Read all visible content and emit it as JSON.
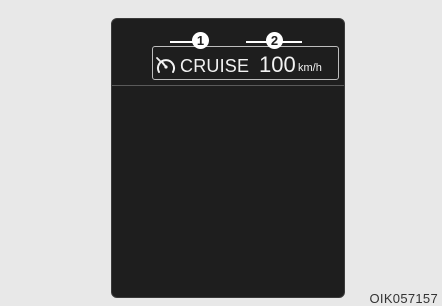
{
  "display": {
    "mode_label": "CRUISE",
    "set_speed": "100",
    "speed_unit": "km/h",
    "icon": "cruise-speedometer-icon"
  },
  "callouts": {
    "first": "1",
    "second": "2"
  },
  "figure_code": "OIK057157",
  "colors": {
    "background": "#e8e8e8",
    "screen": "#1e1e1e",
    "text": "#f2f2f2",
    "border": "#bdbdbd"
  }
}
